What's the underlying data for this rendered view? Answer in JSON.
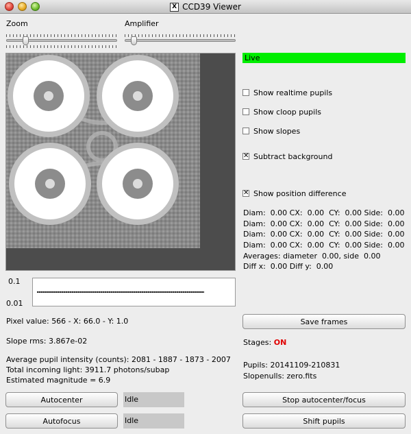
{
  "window": {
    "title": "CCD39 Viewer"
  },
  "controls": {
    "zoom_label": "Zoom",
    "amplifier_label": "Amplifier"
  },
  "live_label": "Live",
  "options": {
    "realtime_pupils": {
      "label": "Show realtime pupils",
      "checked": false
    },
    "cloop_pupils": {
      "label": "Show cloop pupils",
      "checked": false
    },
    "slopes": {
      "label": "Show slopes",
      "checked": false
    },
    "subtract_background": {
      "label": "Subtract background",
      "checked": true
    },
    "position_difference": {
      "label": "Show position difference",
      "checked": true
    }
  },
  "pupil_stats": [
    "Diam:  0.00 CX:  0.00  CY:  0.00 Side:  0.00",
    "Diam:  0.00 CX:  0.00  CY:  0.00 Side:  0.00",
    "Diam:  0.00 CX:  0.00  CY:  0.00 Side:  0.00",
    "Diam:  0.00 CX:  0.00  CY:  0.00 Side:  0.00"
  ],
  "averages": "Averages: diameter  0.00, side  0.00",
  "diff": "Diff x:  0.00 Diff y:  0.00",
  "plot": {
    "ytick_top": "0.1",
    "ytick_bottom": "0.01"
  },
  "pixel_value": "Pixel value: 566 - X:  66.0 - Y:   1.0",
  "slope_rms": "Slope rms: 3.867e-02",
  "pupil_intensity": "Average pupil intensity (counts): 2081 - 1887 - 1873 - 2007",
  "incoming_light": "Total incoming light: 3911.7 photons/subap",
  "magnitude": "Estimated magnitude =   6.9",
  "stages": {
    "label": "Stages:",
    "value": "ON",
    "value_color": "#e00000"
  },
  "pupils": "Pupils: 20141109-210831",
  "slopenulls": "Slopenulls: zero.fits",
  "buttons": {
    "save_frames": "Save frames",
    "autocenter": "Autocenter",
    "autofocus": "Autofocus",
    "stop_autocenter": "Stop autocenter/focus",
    "shift_pupils": "Shift pupils"
  },
  "status": {
    "autocenter": "Idle",
    "autofocus": "Idle"
  }
}
